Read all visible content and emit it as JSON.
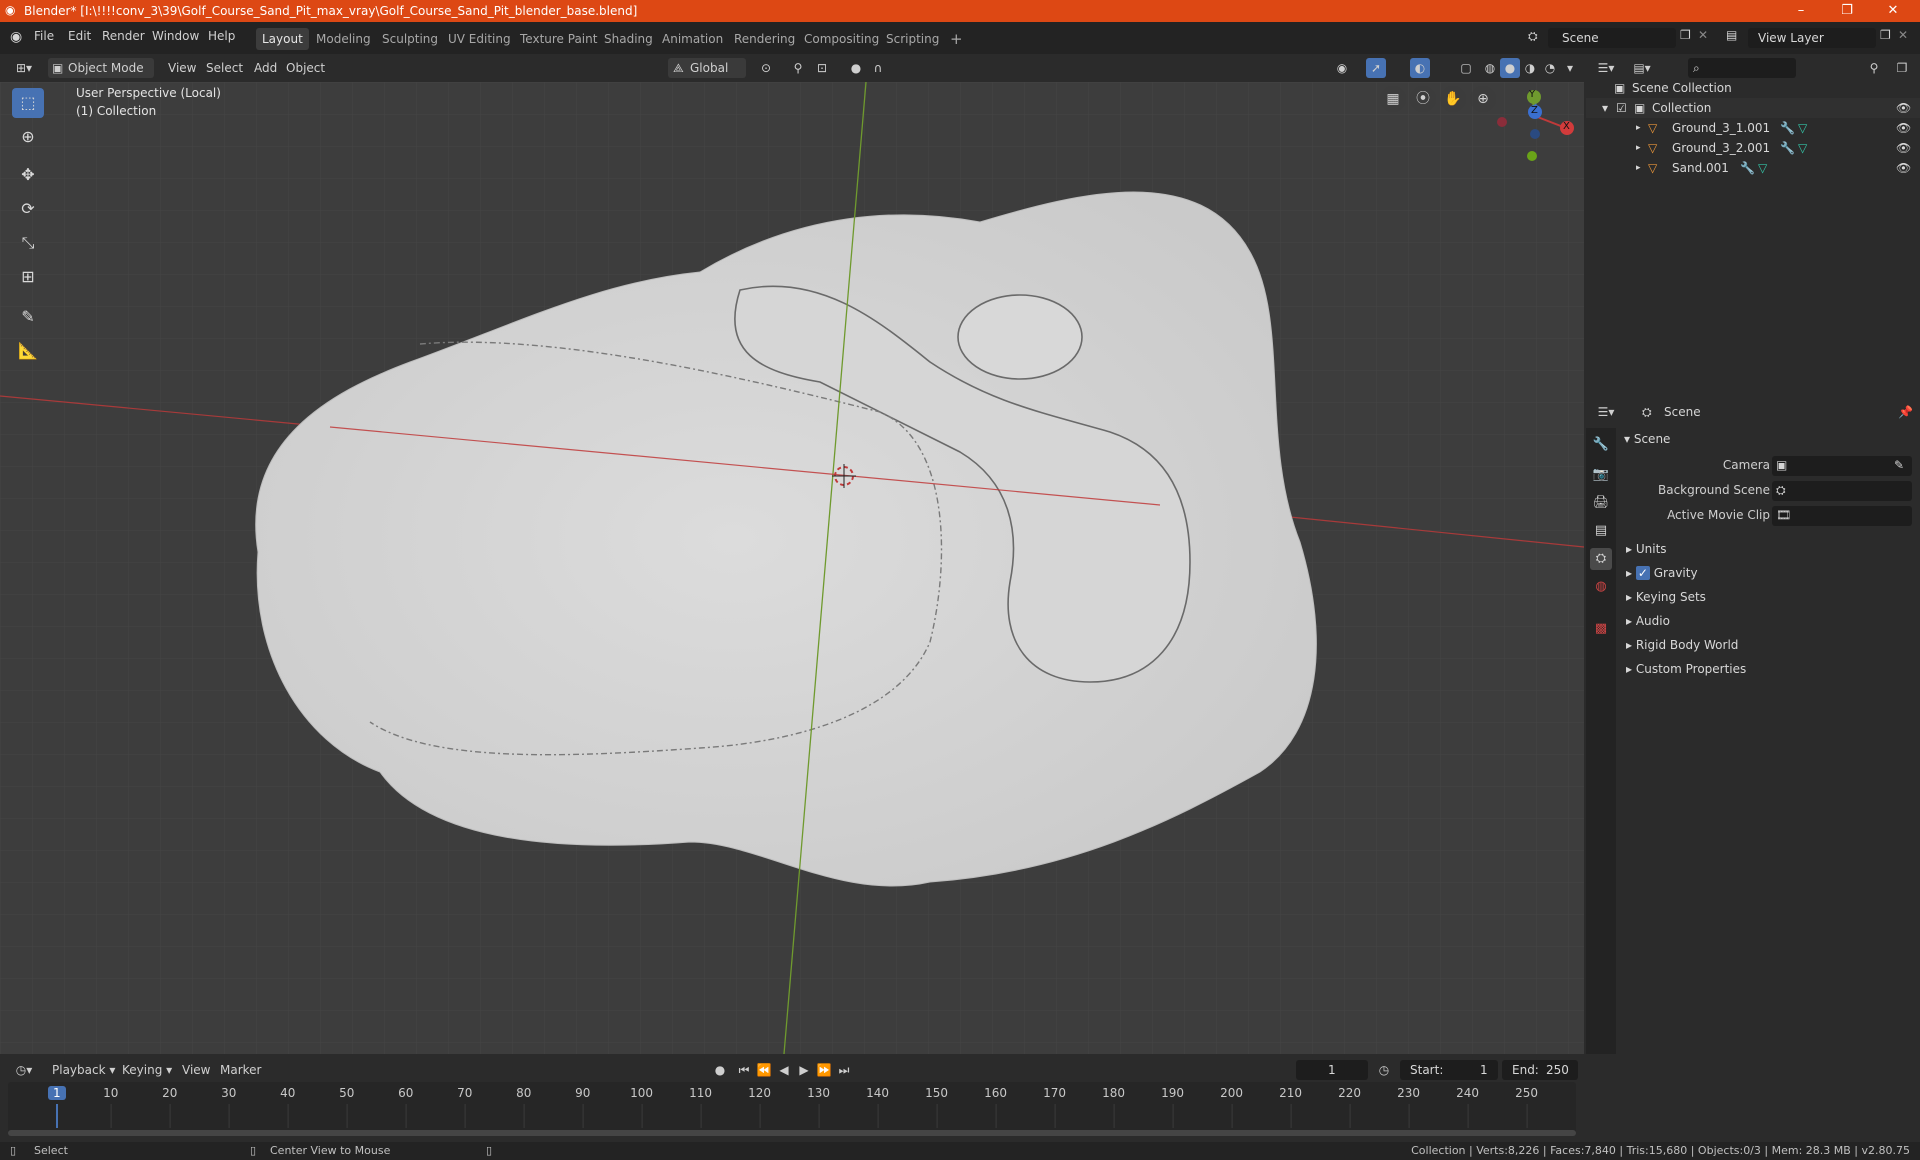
{
  "window": {
    "title": "Blender* [I:\\!!!!conv_3\\39\\Golf_Course_Sand_Pit_max_vray\\Golf_Course_Sand_Pit_blender_base.blend]",
    "minimize": "–",
    "maximize": "❐",
    "close": "✕"
  },
  "menu": {
    "file": "File",
    "edit": "Edit",
    "render": "Render",
    "window": "Window",
    "help": "Help"
  },
  "workspaces": [
    "Layout",
    "Modeling",
    "Sculpting",
    "UV Editing",
    "Texture Paint",
    "Shading",
    "Animation",
    "Rendering",
    "Compositing",
    "Scripting"
  ],
  "workspace_add": "+",
  "scene_field": "Scene",
  "view_layer_field": "View Layer",
  "viewport_header": {
    "mode": "Object Mode",
    "view": "View",
    "select": "Select",
    "add": "Add",
    "object": "Object",
    "orientation": "Global"
  },
  "viewport": {
    "perspective": "User Perspective (Local)",
    "collection": "(1) Collection",
    "gizmo": {
      "x": "X",
      "y": "Y",
      "z": "Z"
    }
  },
  "outliner": {
    "root": "Scene Collection",
    "collection": "Collection",
    "objects": [
      "Ground_3_1.001",
      "Ground_3_2.001",
      "Sand.001"
    ]
  },
  "properties": {
    "context": "Scene",
    "panel_title": "Scene",
    "camera_label": "Camera",
    "background_label": "Background Scene",
    "movie_clip_label": "Active Movie Clip",
    "sections": [
      "Units",
      "Gravity",
      "Keying Sets",
      "Audio",
      "Rigid Body World",
      "Custom Properties"
    ],
    "gravity_enabled": true
  },
  "timeline": {
    "playback": "Playback",
    "keying": "Keying",
    "view": "View",
    "marker": "Marker",
    "current_frame": "1",
    "start_label": "Start:",
    "start": "1",
    "end_label": "End:",
    "end": "250",
    "ticks": [
      "1",
      "10",
      "20",
      "30",
      "40",
      "50",
      "60",
      "70",
      "80",
      "90",
      "100",
      "110",
      "120",
      "130",
      "140",
      "150",
      "160",
      "170",
      "180",
      "190",
      "200",
      "210",
      "220",
      "230",
      "240",
      "250"
    ]
  },
  "statusbar": {
    "select": "Select",
    "center": "Center View to Mouse",
    "stats": "Collection | Verts:8,226 | Faces:7,840 | Tris:15,680 | Objects:0/3 | Mem: 28.3 MB | v2.80.75"
  },
  "colors": {
    "title_bar": "#dd4814",
    "active_blue": "#4772b3",
    "x_axis": "#c03a3a",
    "y_axis": "#7ab83a"
  }
}
